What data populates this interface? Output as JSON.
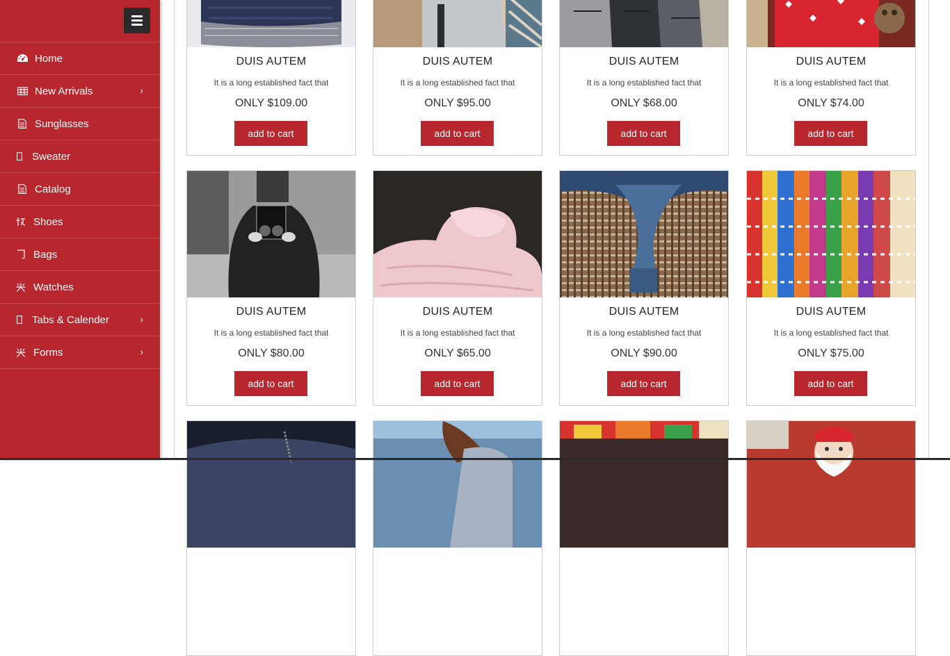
{
  "sidebar": {
    "items": [
      {
        "label": "Home",
        "icon": "dashboard-icon",
        "chevron": false
      },
      {
        "label": "New Arrivals",
        "icon": "table-icon",
        "chevron": true
      },
      {
        "label": "Sunglasses",
        "icon": "file-icon",
        "chevron": false
      },
      {
        "label": "Sweater",
        "icon": "mobile-icon",
        "chevron": false
      },
      {
        "label": "Catalog",
        "icon": "file-icon",
        "chevron": false
      },
      {
        "label": "Shoes",
        "icon": "glyph-icon",
        "chevron": false
      },
      {
        "label": "Bags",
        "icon": "glyph-icon",
        "chevron": false
      },
      {
        "label": "Watches",
        "icon": "glyph-icon",
        "chevron": false
      },
      {
        "label": "Tabs & Calender",
        "icon": "mobile-icon",
        "chevron": true
      },
      {
        "label": "Forms",
        "icon": "glyph-icon",
        "chevron": true
      }
    ],
    "chevron_glyph": "›"
  },
  "products": {
    "row1": [
      {
        "title": "DUIS AUTEM",
        "desc": "It is a long established fact that",
        "price": "ONLY $109.00",
        "button": "add to cart",
        "image": "knit-hat-photo"
      },
      {
        "title": "DUIS AUTEM",
        "desc": "It is a long established fact that",
        "price": "ONLY $95.00",
        "button": "add to cart",
        "image": "gray-sweater-photo"
      },
      {
        "title": "DUIS AUTEM",
        "desc": "It is a long established fact that",
        "price": "ONLY $68.00",
        "button": "add to cart",
        "image": "crowd-coats-photo"
      },
      {
        "title": "DUIS AUTEM",
        "desc": "It is a long established fact that",
        "price": "ONLY $74.00",
        "button": "add to cart",
        "image": "santa-sweater-photo"
      }
    ],
    "row2": [
      {
        "title": "DUIS AUTEM",
        "desc": "It is a long established fact that",
        "price": "ONLY $80.00",
        "button": "add to cart",
        "image": "camera-man-photo"
      },
      {
        "title": "DUIS AUTEM",
        "desc": "It is a long established fact that",
        "price": "ONLY $65.00",
        "button": "add to cart",
        "image": "pink-sweater-photo"
      },
      {
        "title": "DUIS AUTEM",
        "desc": "It is a long established fact that",
        "price": "ONLY $90.00",
        "button": "add to cart",
        "image": "blue-sweater-photo"
      },
      {
        "title": "DUIS AUTEM",
        "desc": "It is a long established fact that",
        "price": "ONLY $75.00",
        "button": "add to cart",
        "image": "colorful-knits-photo"
      }
    ],
    "row3": [
      {
        "image": "dark-knit-photo"
      },
      {
        "image": "woman-sweater-photo"
      },
      {
        "image": "market-stall-photo"
      },
      {
        "image": "santa-figure-photo"
      }
    ]
  },
  "colors": {
    "sidebar_bg": "#b8262e",
    "button_bg": "#b8262e",
    "toggle_bg": "#2a2a2a"
  }
}
